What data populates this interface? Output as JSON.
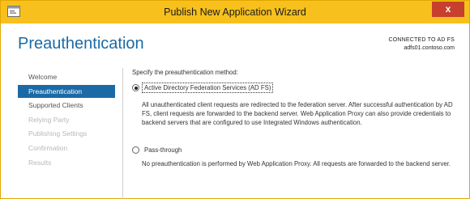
{
  "window": {
    "title": "Publish New Application Wizard",
    "close_label": "x"
  },
  "header": {
    "page_title": "Preauthentication",
    "connection_label": "CONNECTED TO AD FS",
    "connection_server": "adfs01.contoso.com"
  },
  "nav": {
    "items": [
      {
        "label": "Welcome",
        "state": "enabled"
      },
      {
        "label": "Preauthentication",
        "state": "selected"
      },
      {
        "label": "Supported Clients",
        "state": "enabled"
      },
      {
        "label": "Relying Party",
        "state": "disabled"
      },
      {
        "label": "Publishing Settings",
        "state": "disabled"
      },
      {
        "label": "Confirmation",
        "state": "disabled"
      },
      {
        "label": "Results",
        "state": "disabled"
      }
    ]
  },
  "main": {
    "prompt": "Specify the preauthentication method:",
    "options": [
      {
        "label": "Active Directory Federation Services (AD FS)",
        "selected": true,
        "description": "All unauthenticated client requests are redirected to the federation server. After successful authentication by AD FS, client requests are forwarded to the backend server. Web Application Proxy can also provide credentials to backend servers that are configured to use Integrated Windows authentication."
      },
      {
        "label": "Pass-through",
        "selected": false,
        "description": "No preauthentication is performed by Web Application Proxy. All requests are forwarded to the backend server."
      }
    ]
  },
  "colors": {
    "titlebar": "#f7c01c",
    "accent": "#1b6aa5",
    "close": "#c7402d"
  }
}
